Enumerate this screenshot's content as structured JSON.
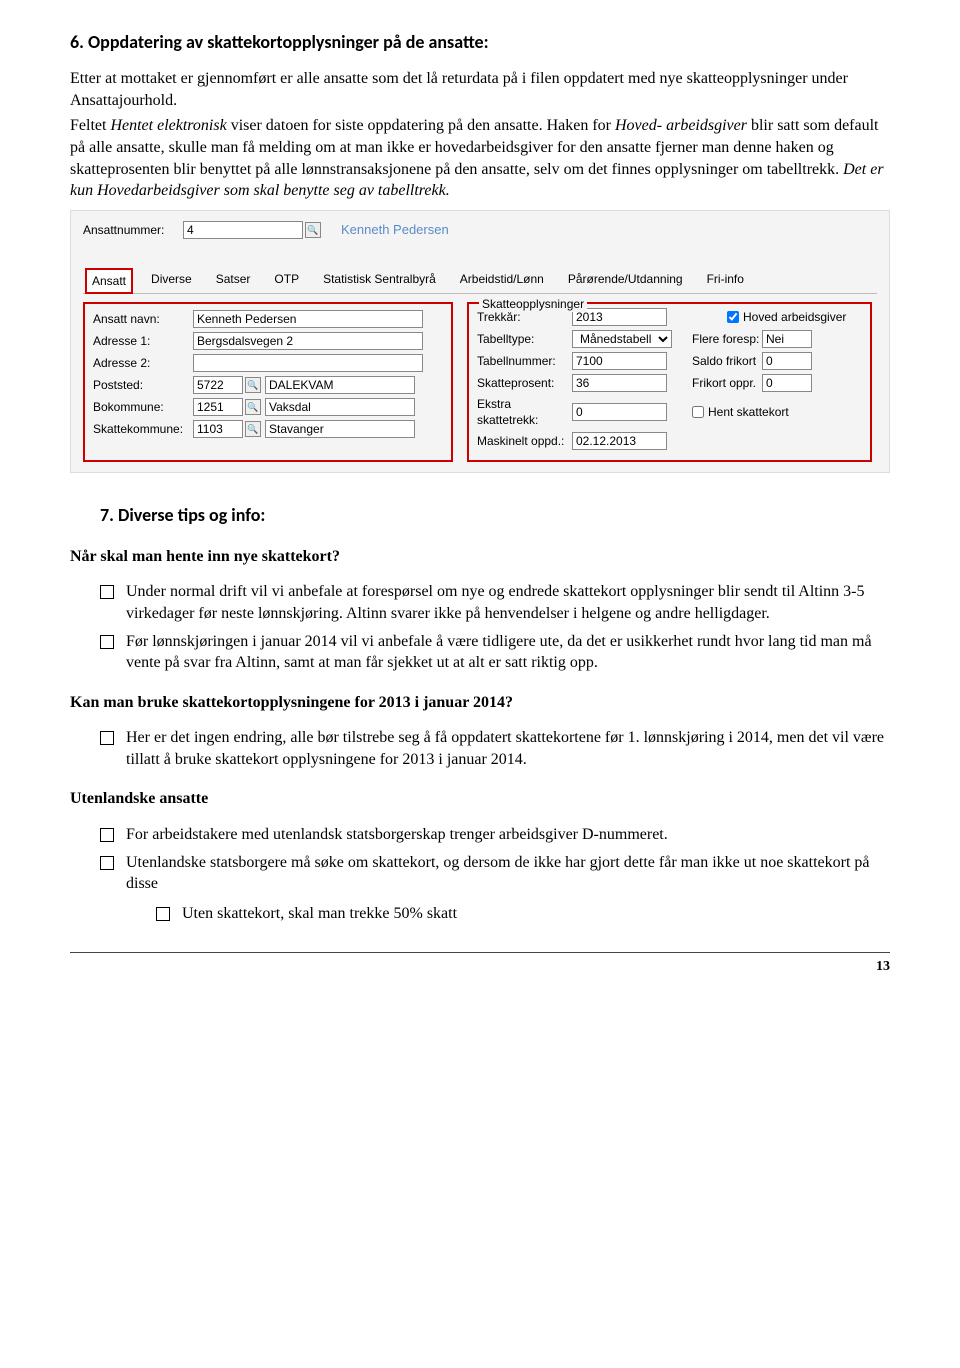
{
  "section6": {
    "heading": "6.  Oppdatering av skattekortopplysninger på de ansatte:",
    "p1a": "Etter at mottaket er gjennomført er alle ansatte som det lå returdata på i filen oppdatert med nye skatteopplysninger under Ansattajourhold.",
    "p2a": "Feltet ",
    "p2b": "Hentet elektronisk",
    "p2c": " viser datoen for siste oppdatering på den ansatte. Haken for ",
    "p2d": "Hoved- arbeidsgiver",
    "p2e": " blir satt som default på alle ansatte, skulle man få melding om at man ikke er hovedarbeidsgiver for den ansatte fjerner man denne haken og skatteprosenten blir benyttet på alle lønnstransaksjonene på den ansatte, selv om det finnes opplysninger om tabelltrekk. ",
    "p2f": "Det er kun Hovedarbeidsgiver som skal benytte seg av tabelltrekk."
  },
  "appshot": {
    "ansattnummer_label": "Ansattnummer:",
    "ansattnummer_value": "4",
    "emp_name": "Kenneth Pedersen",
    "tabs": [
      "Ansatt",
      "Diverse",
      "Satser",
      "OTP",
      "Statistisk Sentralbyrå",
      "Arbeidstid/Lønn",
      "Pårørende/Utdanning",
      "Fri-info"
    ],
    "left": {
      "navn_label": "Ansatt navn:",
      "navn": "Kenneth Pedersen",
      "adr1_label": "Adresse 1:",
      "adr1": "Bergsdalsvegen 2",
      "adr2_label": "Adresse 2:",
      "adr2": "",
      "post_label": "Poststed:",
      "postnr": "5722",
      "poststed": "DALEKVAM",
      "bok_label": "Bokommune:",
      "boknr": "1251",
      "bokname": "Vaksdal",
      "skk_label": "Skattekommune:",
      "skknr": "1103",
      "skkname": "Stavanger"
    },
    "right": {
      "group": "Skatteopplysninger",
      "trekkar_label": "Trekkår:",
      "trekkar": "2013",
      "hoved_label": "Hoved arbeidsgiver",
      "tabelltype_label": "Tabelltype:",
      "tabelltype": "Månedstabell",
      "flere_label": "Flere foresp:",
      "flere": "Nei",
      "tabellnr_label": "Tabellnummer:",
      "tabellnr": "7100",
      "saldo_label": "Saldo frikort",
      "saldo": "0",
      "pros_label": "Skatteprosent:",
      "pros": "36",
      "frikort_label": "Frikort oppr.",
      "frikort": "0",
      "ekstra_label": "Ekstra skattetrekk:",
      "ekstra": "0",
      "hent_label": "Hent skattekort",
      "mask_label": "Maskinelt oppd.:",
      "mask": "02.12.2013"
    }
  },
  "section7": {
    "heading": "7.  Diverse tips og info:",
    "q1": "Når skal man hente inn nye skattekort?",
    "q1_items": [
      "Under normal drift vil vi anbefale at forespørsel om nye og endrede skattekort opplysninger blir sendt til Altinn 3-5 virkedager før neste lønnskjøring. Altinn svarer ikke på henvendelser i helgene og andre helligdager.",
      "Før lønnskjøringen i januar 2014 vil vi anbefale å være tidligere ute, da det er usikkerhet rundt hvor lang tid man må vente på svar fra Altinn, samt at man får sjekket ut at alt er satt riktig opp."
    ],
    "q2": "Kan man bruke skattekortopplysningene for 2013 i januar 2014?",
    "q2_items": [
      "Her er det ingen endring, alle bør tilstrebe seg å få oppdatert skattekortene før 1. lønnskjøring i 2014, men det vil være tillatt å bruke skattekort opplysningene for 2013 i januar 2014."
    ],
    "q3": "Utenlandske ansatte",
    "q3_items": [
      "For arbeidstakere med utenlandsk statsborgerskap trenger arbeidsgiver D-nummeret.",
      "Utenlandske statsborgere må søke om skattekort, og dersom de ikke har gjort dette får man ikke ut noe skattekort på disse"
    ],
    "q3_sub": "Uten skattekort, skal man trekke 50% skatt"
  },
  "page_number": "13"
}
